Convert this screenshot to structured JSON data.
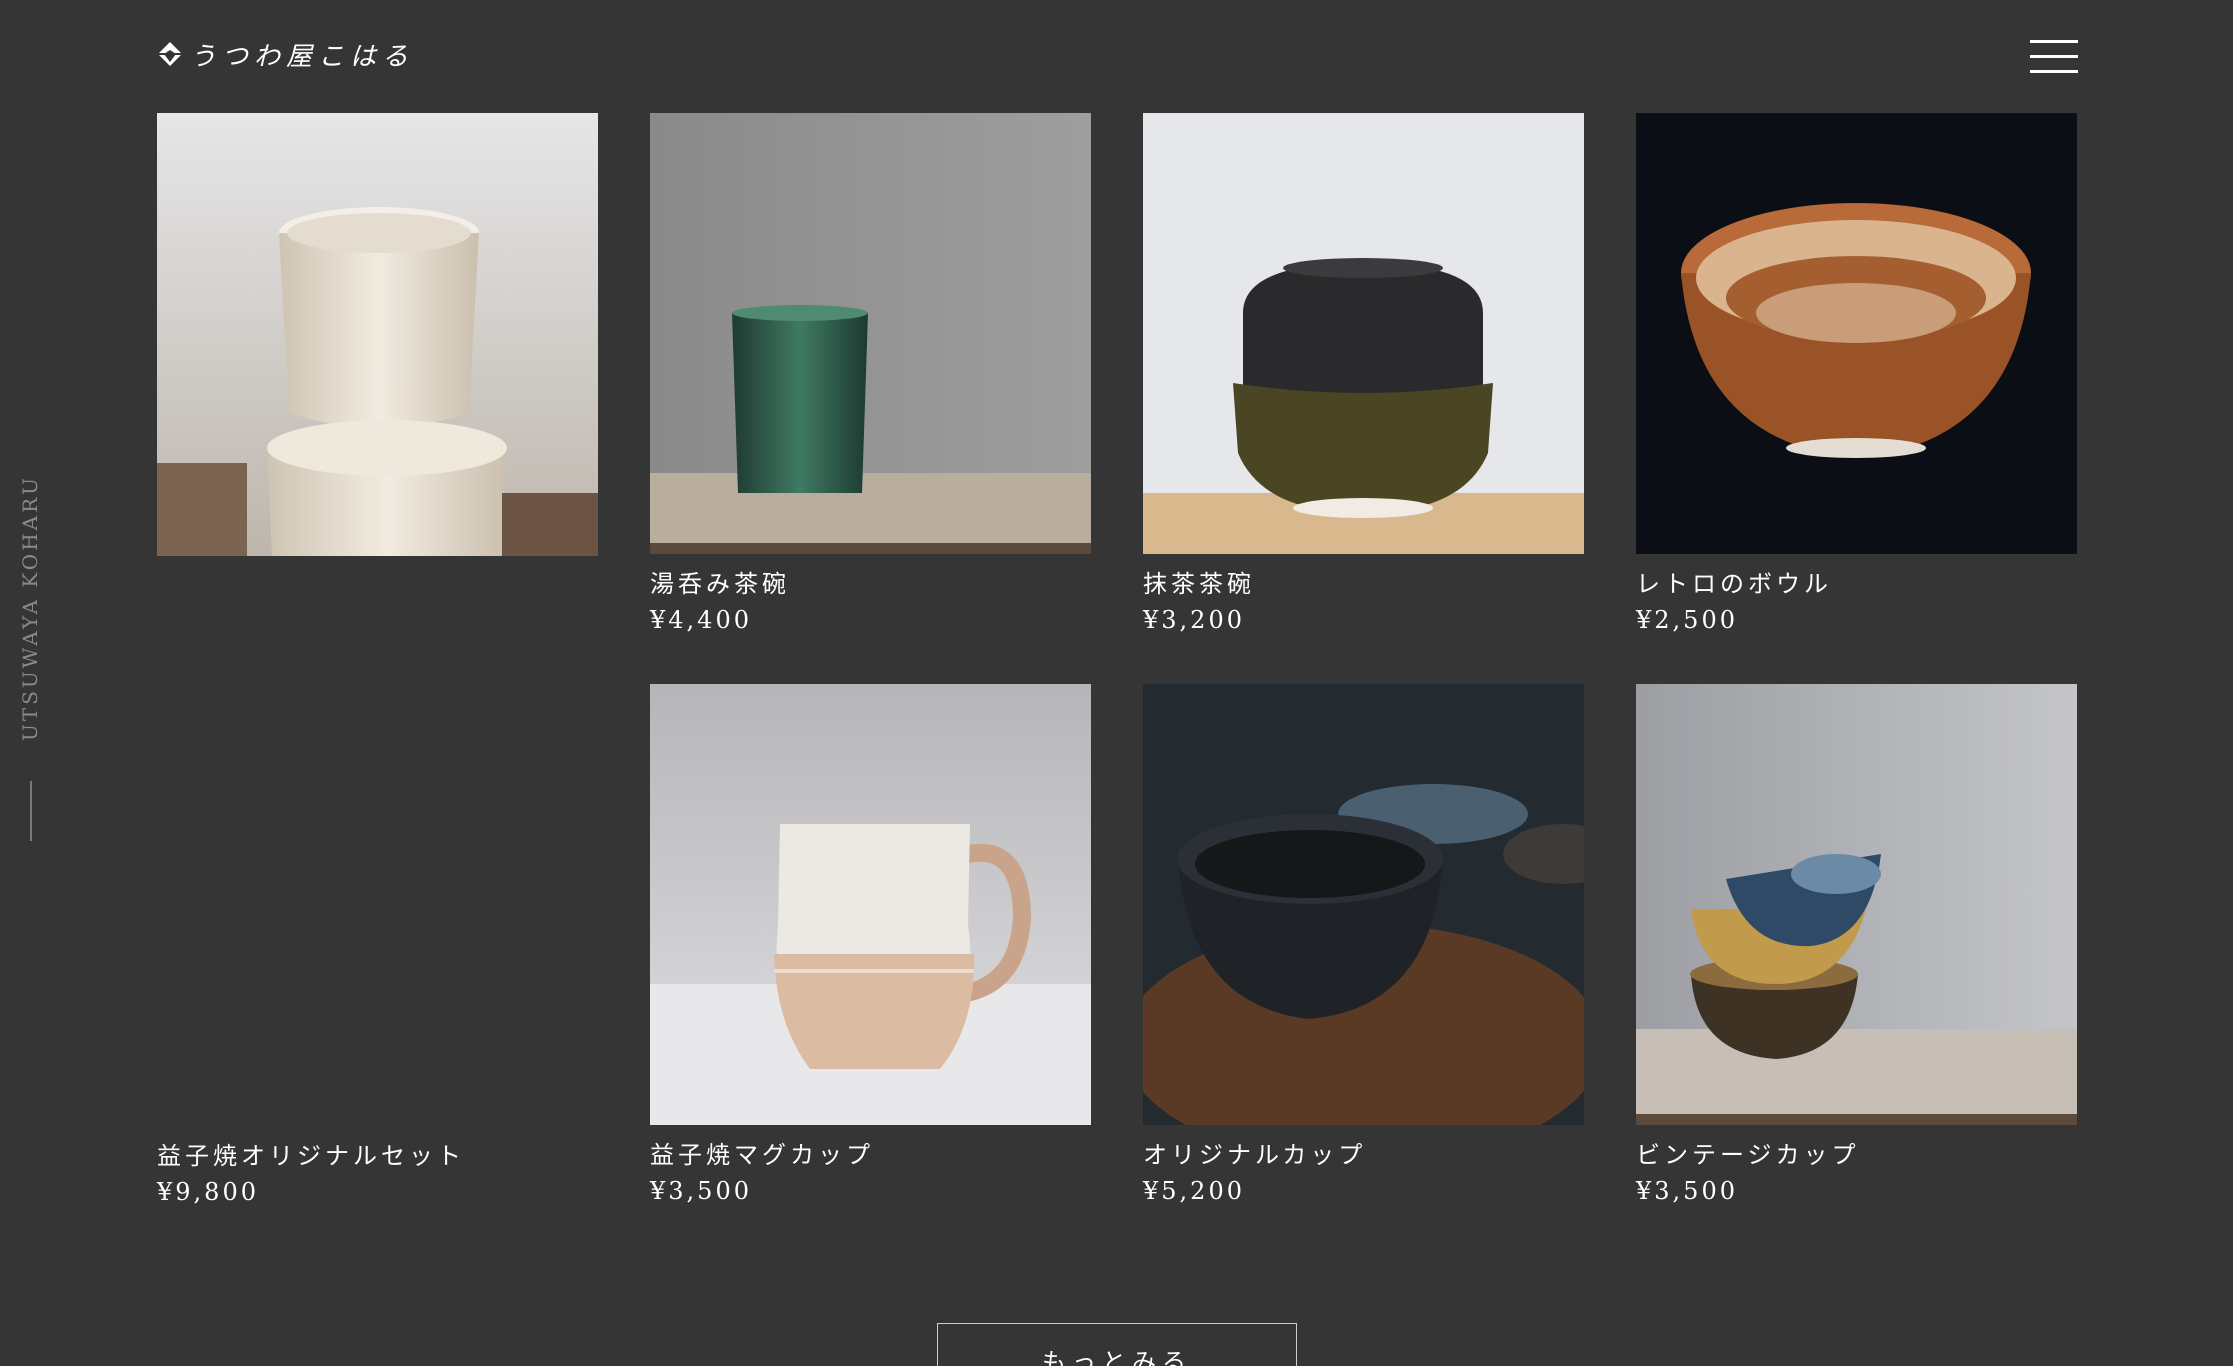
{
  "header": {
    "logo_text": "うつわ屋こはる",
    "menu_icon": "hamburger-icon"
  },
  "side": {
    "label": "UTSUWAYA KOHARU"
  },
  "products": [
    {
      "name": "益子焼オリジナルセット",
      "price": "¥9,800",
      "image": "stacked-speckled-bowls-with-flower"
    },
    {
      "name": "湯呑み茶碗",
      "price": "¥4,400",
      "image": "green-ribbed-teacup"
    },
    {
      "name": "抹茶茶碗",
      "price": "¥3,200",
      "image": "black-glazed-matcha-bowl"
    },
    {
      "name": "レトロのボウル",
      "price": "¥2,500",
      "image": "brown-striped-bowl"
    },
    {
      "name": "益子焼マグカップ",
      "price": "¥3,500",
      "image": "two-tone-mug"
    },
    {
      "name": "オリジナルカップ",
      "price": "¥5,200",
      "image": "dark-speckled-cups-on-wood"
    },
    {
      "name": "ビンテージカップ",
      "price": "¥3,500",
      "image": "stacked-glazed-cups"
    }
  ],
  "more_button": {
    "label": "もっとみる"
  },
  "colors": {
    "background": "#353535",
    "text": "#ffffff",
    "muted": "#8a8a8a"
  }
}
